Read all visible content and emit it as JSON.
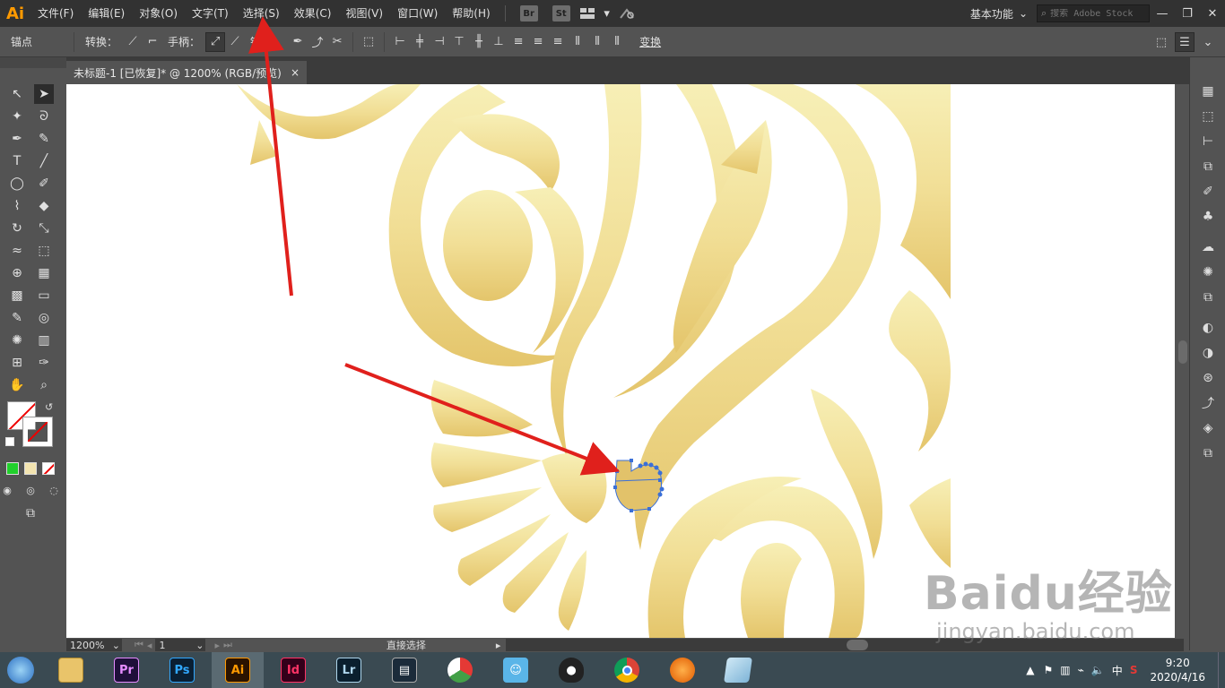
{
  "app": {
    "logo": "Ai"
  },
  "menu": [
    {
      "label": "文件(F)"
    },
    {
      "label": "编辑(E)"
    },
    {
      "label": "对象(O)"
    },
    {
      "label": "文字(T)"
    },
    {
      "label": "选择(S)"
    },
    {
      "label": "效果(C)"
    },
    {
      "label": "视图(V)"
    },
    {
      "label": "窗口(W)"
    },
    {
      "label": "帮助(H)"
    }
  ],
  "bridge": {
    "br": "Br",
    "st": "St"
  },
  "workspace": {
    "label": "基本功能"
  },
  "search": {
    "placeholder": "搜索 Adobe Stock"
  },
  "controlbar": {
    "anchor_label": "锚点",
    "convert_label": "转换：",
    "handles_label": "手柄：",
    "anchors_label": "锚点：",
    "transform_label": "变换"
  },
  "document_tab": {
    "title": "未标题-1 [已恢复]* @ 1200% (RGB/预览)",
    "close": "×"
  },
  "status": {
    "zoom": "1200%",
    "page": "1",
    "tool_text": "直接选择"
  },
  "taskbar": {
    "apps": [
      {
        "name": "Pr",
        "bg": "#1f0f3a",
        "fg": "#e58cff"
      },
      {
        "name": "Ps",
        "bg": "#0a1f33",
        "fg": "#31a8ff"
      },
      {
        "name": "Ai",
        "bg": "#2a1300",
        "fg": "#ff9a00"
      },
      {
        "name": "Id",
        "bg": "#33001a",
        "fg": "#ff3366"
      },
      {
        "name": "Lr",
        "bg": "#0a1f2e",
        "fg": "#add5ec"
      }
    ],
    "clock_time": "9:20",
    "clock_date": "2020/4/16",
    "ime": "中"
  },
  "watermark": {
    "logo": "Baidu经验",
    "url": "jingyan.baidu.com"
  },
  "colors": {
    "accent_gold_light": "#f6eeb4",
    "accent_gold_dark": "#e3c46c",
    "arrow": "#e0201c",
    "selection": "#3a6fd8"
  }
}
